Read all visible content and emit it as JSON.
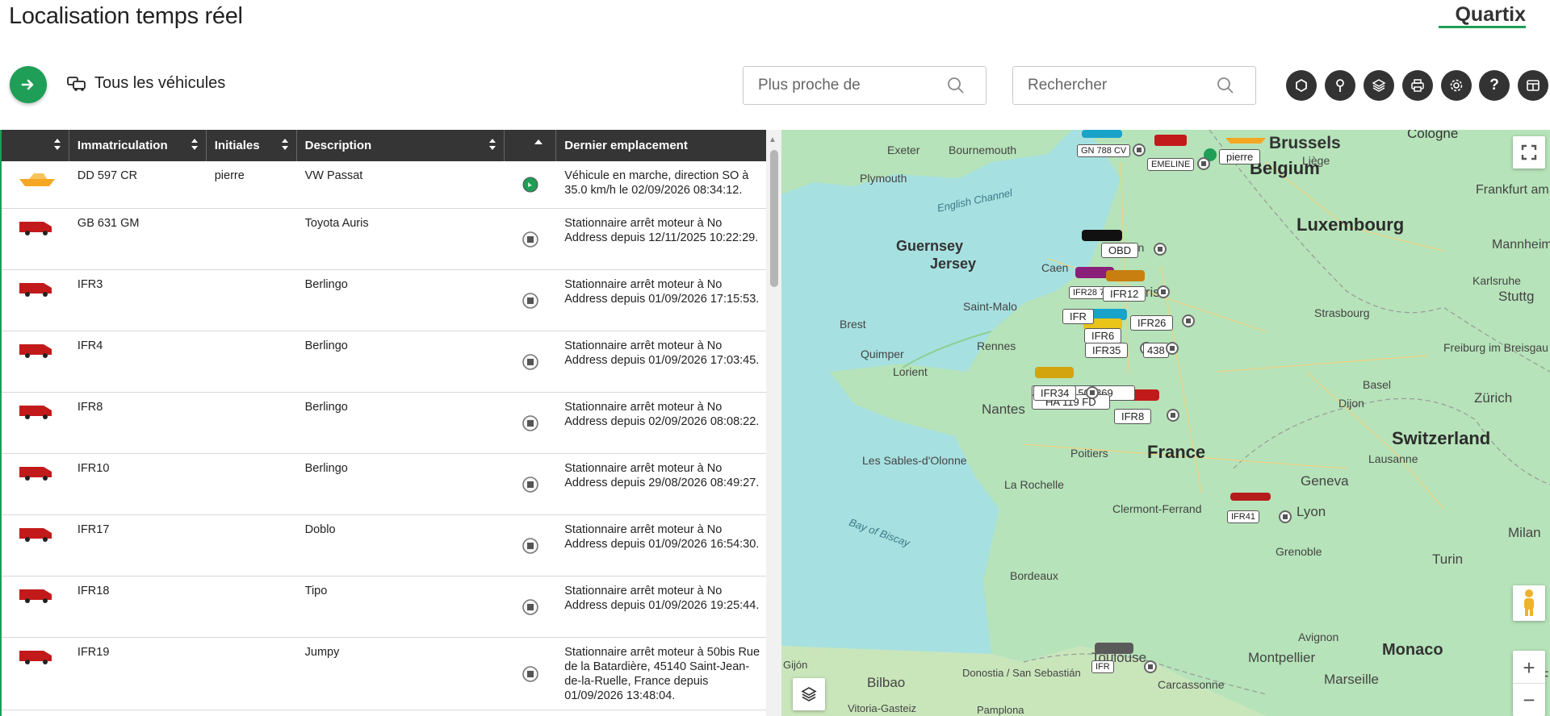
{
  "header": {
    "title": "Localisation temps réel",
    "brand": "Quartix",
    "vehicle_filter_label": "Tous les véhicules"
  },
  "search": {
    "near_placeholder": "Plus proche de",
    "search_placeholder": "Rechercher"
  },
  "toolbar": {
    "icons": [
      "geofence-icon",
      "pin-icon",
      "layers-icon",
      "print-icon",
      "settings-icon",
      "help-icon",
      "layout-icon"
    ],
    "labels": [
      "?"
    ]
  },
  "table": {
    "columns": [
      "Immatriculation",
      "Initiales",
      "Description",
      "Dernier emplacement"
    ],
    "rows": [
      {
        "reg": "DD 597 CR",
        "initials": "pierre",
        "desc": "VW Passat",
        "state": "moving",
        "location": "Véhicule en marche, direction SO à 35.0 km/h le 02/09/2026 08:34:12.",
        "icon": "boat"
      },
      {
        "reg": "GB 631 GM",
        "initials": "",
        "desc": "Toyota Auris",
        "state": "stopped",
        "location": "Stationnaire arrêt moteur à No Address depuis 12/11/2025 10:22:29.",
        "icon": "van"
      },
      {
        "reg": "IFR3",
        "initials": "",
        "desc": "Berlingo",
        "state": "stopped",
        "location": "Stationnaire arrêt moteur à No Address depuis 01/09/2026 17:15:53.",
        "icon": "van"
      },
      {
        "reg": "IFR4",
        "initials": "",
        "desc": "Berlingo",
        "state": "stopped",
        "location": "Stationnaire arrêt moteur à No Address depuis 01/09/2026 17:03:45.",
        "icon": "van"
      },
      {
        "reg": "IFR8",
        "initials": "",
        "desc": "Berlingo",
        "state": "stopped",
        "location": "Stationnaire arrêt moteur à No Address depuis 02/09/2026 08:08:22.",
        "icon": "van"
      },
      {
        "reg": "IFR10",
        "initials": "",
        "desc": "Berlingo",
        "state": "stopped",
        "location": "Stationnaire arrêt moteur à No Address depuis 29/08/2026 08:49:27.",
        "icon": "van"
      },
      {
        "reg": "IFR17",
        "initials": "",
        "desc": "Doblo",
        "state": "stopped",
        "location": "Stationnaire arrêt moteur à No Address depuis 01/09/2026 16:54:30.",
        "icon": "van"
      },
      {
        "reg": "IFR18",
        "initials": "",
        "desc": "Tipo",
        "state": "stopped",
        "location": "Stationnaire arrêt moteur à No Address depuis 01/09/2026 19:25:44.",
        "icon": "van"
      },
      {
        "reg": "IFR19",
        "initials": "",
        "desc": "Jumpy",
        "state": "stopped",
        "location": "Stationnaire arrêt moteur à 50bis Rue de la Batardière, 45140 Saint-Jean-de-la-Ruelle, France depuis 01/09/2026 13:48:04.",
        "icon": "van"
      }
    ]
  },
  "map": {
    "places": [
      {
        "name": "Exeter"
      },
      {
        "name": "Bournemouth"
      },
      {
        "name": "Plymouth"
      },
      {
        "name": "Brussels"
      },
      {
        "name": "Liège"
      },
      {
        "name": "Cologne"
      },
      {
        "name": "Belgium"
      },
      {
        "name": "Frankfurt am Main"
      },
      {
        "name": "Luxembourg"
      },
      {
        "name": "Mannheim"
      },
      {
        "name": "Karlsruhe"
      },
      {
        "name": "Stuttg"
      },
      {
        "name": "Strasbourg"
      },
      {
        "name": "Freiburg im Breisgau"
      },
      {
        "name": "Basel"
      },
      {
        "name": "Zürich"
      },
      {
        "name": "Switzerland"
      },
      {
        "name": "Lausanne"
      },
      {
        "name": "Geneva"
      },
      {
        "name": "Lyon"
      },
      {
        "name": "Grenoble"
      },
      {
        "name": "Turin"
      },
      {
        "name": "Milan"
      },
      {
        "name": "Ge"
      },
      {
        "name": "Avignon"
      },
      {
        "name": "Montpellier"
      },
      {
        "name": "Monaco"
      },
      {
        "name": "Marseille"
      },
      {
        "name": "Toulouse"
      },
      {
        "name": "Carcassonne"
      },
      {
        "name": "Bilbao"
      },
      {
        "name": "Donostia / San Sebastián"
      },
      {
        "name": "Vitoria-Gasteiz"
      },
      {
        "name": "Pamplona"
      },
      {
        "name": "Gijón"
      },
      {
        "name": "Bordeaux"
      },
      {
        "name": "La Rochelle"
      },
      {
        "name": "Les Sables-d'Olonne"
      },
      {
        "name": "Poitiers"
      },
      {
        "name": "Clermont-Ferrand"
      },
      {
        "name": "Dijon"
      },
      {
        "name": "France"
      },
      {
        "name": "Nantes"
      },
      {
        "name": "Lorient"
      },
      {
        "name": "Quimper"
      },
      {
        "name": "Brest"
      },
      {
        "name": "Rennes"
      },
      {
        "name": "Saint-Malo"
      },
      {
        "name": "Caen"
      },
      {
        "name": "Rouen"
      },
      {
        "name": "Paris"
      },
      {
        "name": "Guernsey"
      },
      {
        "name": "Jersey"
      },
      {
        "name": "English Channel"
      },
      {
        "name": "Bay of Biscay"
      },
      {
        "name": "F"
      }
    ],
    "markers": [
      "GN 788 CV",
      "EMELINE",
      "pierre",
      "OBD",
      "IFR28 7",
      "IFR12",
      "IFR",
      "IFR26",
      "IFR35",
      "438",
      "IFR6",
      "IFR8",
      "IFR34",
      "HA 119 FD",
      "QTX 508869",
      "IFR41",
      "IFR"
    ],
    "controls": {
      "zoom_in": "+",
      "zoom_out": "−"
    }
  }
}
